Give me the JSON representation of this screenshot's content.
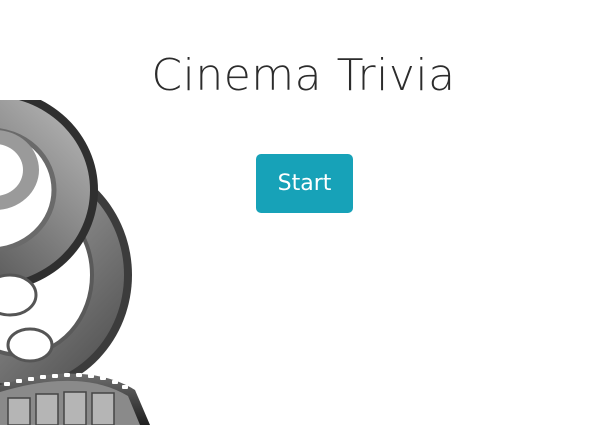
{
  "app": {
    "title": "Cinema Trivia",
    "start_label": "Start"
  },
  "colors": {
    "accent": "#17a2b8",
    "title_text": "#2c2c2c",
    "background": "#ffffff"
  },
  "icons": {
    "decoration": "film-reel-icon"
  }
}
